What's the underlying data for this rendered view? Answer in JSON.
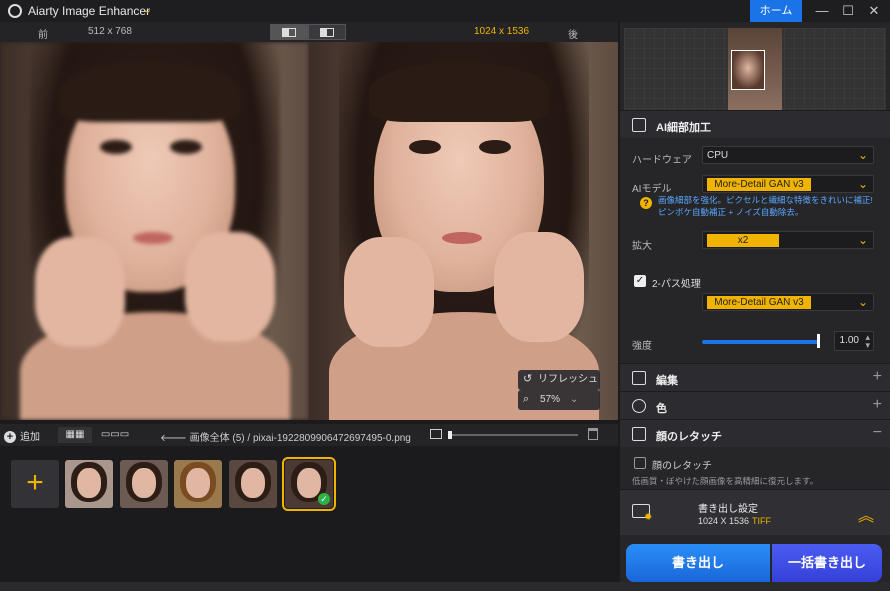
{
  "app": {
    "title": "Aiarty Image Enhancer",
    "home_label": "ホーム"
  },
  "compare": {
    "before_label": "前",
    "before_size": "512 x 768",
    "after_size": "1024 x 1536",
    "after_label": "後"
  },
  "viewer": {
    "refresh_label": "リフレッシュ",
    "zoom_value": "57%"
  },
  "strip_toolbar": {
    "add_label": "追加",
    "breadcrumb_root": "画像全体 (5)",
    "breadcrumb_sep": "/",
    "filename": "pixai-1922809906472697495-0.png"
  },
  "thumbnails": 5,
  "panel": {
    "ai_detail": {
      "title": "AI細部加工",
      "hardware_label": "ハードウェア",
      "hardware_value": "CPU",
      "model_label": "AIモデル",
      "model_value": "More-Detail GAN  v3",
      "hint": "画像細部を強化。ピクセルと繊細な特徴をきれいに補正! ピンボケ自動補正 + ノイズ自動除去。",
      "scale_label": "拡大",
      "scale_value": "x2",
      "twopass_label": "2-パス処理",
      "twopass_model": "More-Detail GAN  v3",
      "strength_label": "強度",
      "strength_value": "1.00"
    },
    "edit_title": "編集",
    "color_title": "色",
    "retouch": {
      "title": "顔のレタッチ",
      "check_label": "顔のレタッチ",
      "desc": "低画質・ぼやけた顔画像を高精細に復元します。"
    },
    "export_settings": {
      "title": "書き出し設定",
      "size": "1024 X 1536",
      "format": "TIFF"
    },
    "export_label": "書き出し",
    "batch_label": "一括書き出し"
  }
}
